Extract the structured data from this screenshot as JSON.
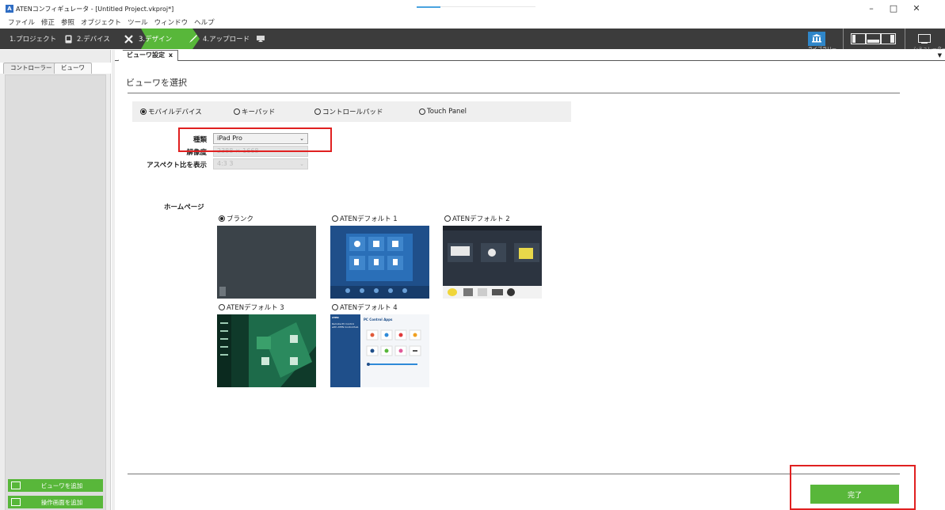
{
  "window": {
    "title": "ATENコンフィギュレータ - [Untitled Project.vkproj*]",
    "logo_letter": "A",
    "minimize": "–",
    "maximize": "□",
    "close": "✕"
  },
  "menu": [
    "ファイル",
    "修正",
    "参照",
    "オブジェクト",
    "ツール",
    "ウィンドウ",
    "ヘルプ"
  ],
  "steps": [
    {
      "label": "1.プロジェクト"
    },
    {
      "label": "2.デバイス"
    },
    {
      "label": "3.デザイン",
      "active": true
    },
    {
      "label": "4.アップロード"
    }
  ],
  "ribbon": {
    "library_label": "ライブラリー",
    "simulator_label": "シミュレーター"
  },
  "left_panel": {
    "tabs": [
      "コントローラー",
      "ビューワ"
    ],
    "add_viewer_button": "ビューワを追加",
    "add_control_screen_button": "操作画面を追加"
  },
  "doc_tab": {
    "label": "ビューワ設定",
    "close": "x"
  },
  "main": {
    "title": "ビューワを選択",
    "device_types": [
      {
        "label": "モバイルデバイス",
        "selected": true
      },
      {
        "label": "キーパッド",
        "selected": false
      },
      {
        "label": "コントロールパッド",
        "selected": false
      },
      {
        "label": "Touch Panel",
        "selected": false
      }
    ],
    "type_label": "種類",
    "type_value": "iPad Pro",
    "resolution_label": "解像度",
    "resolution_value": "2388 × 1668",
    "aspect_label": "アスペクト比を表示",
    "aspect_value": "4:3  3",
    "homepage_label": "ホームページ",
    "templates": [
      {
        "label": "ブランク",
        "selected": true
      },
      {
        "label": "ATENデフォルト 1",
        "selected": false
      },
      {
        "label": "ATENデフォルト 2",
        "selected": false
      },
      {
        "label": "ATENデフォルト 3",
        "selected": false
      },
      {
        "label": "ATENデフォルト 4",
        "selected": false
      }
    ],
    "template4_texts": {
      "brand": "ATEN",
      "header": "PC Control Apps",
      "side_text": "Remote PC Control with ATEN Controllhub"
    },
    "done_button": "完了"
  },
  "colors": {
    "accent_green": "#58b73a",
    "highlight_red": "#e02020",
    "stepbar_bg": "#3c3c3c",
    "blue_template": "#1f4f8a"
  }
}
